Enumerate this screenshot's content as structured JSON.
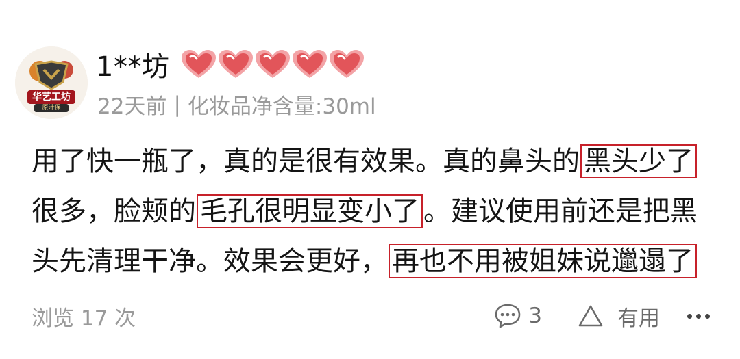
{
  "review": {
    "avatar_text_1": "华艺工坊",
    "avatar_text_2": "原汁保",
    "username": "1**坊",
    "hearts_count": 5,
    "time_ago": "22天前",
    "separator": "|",
    "spec": "化妆品净含量:30ml",
    "content": {
      "p1": "用了快一瓶了，真的是很有效果。真的鼻头的",
      "h1": "黑头少了",
      "p2": "很多，脸颊的",
      "h2": "毛孔很明显变小了",
      "p3": "。建议使用前还是把黑头先清理干净。效果会更好，",
      "h3": "再也不用被姐妹说邋遢了"
    },
    "views_label": "浏览 17 次",
    "comment_count": "3",
    "useful_label": "有用"
  },
  "colors": {
    "highlight_border": "#c7212a",
    "heart": "#e2555a",
    "meta_text": "#9a9a9a"
  }
}
